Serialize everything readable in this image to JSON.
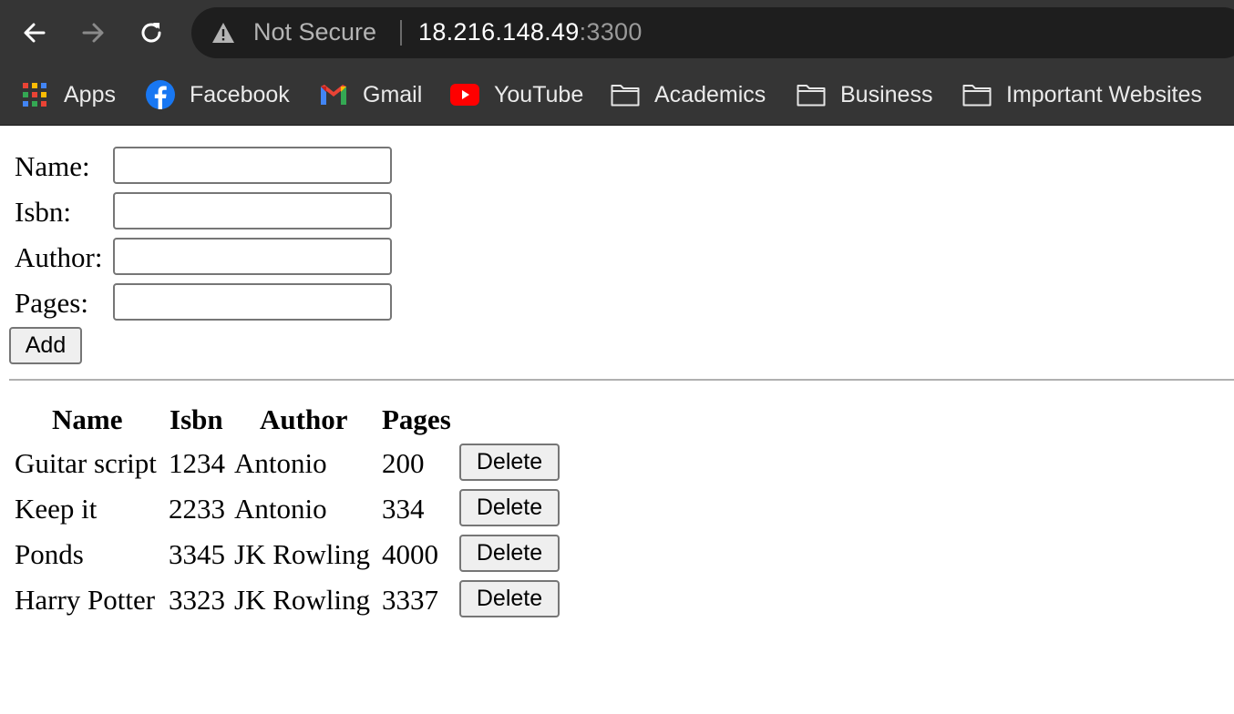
{
  "browser": {
    "security_label": "Not Secure",
    "url_host": "18.216.148.49",
    "url_port": ":3300",
    "icons": {
      "back": "arrow-left-icon",
      "forward": "arrow-right-icon",
      "reload": "reload-icon",
      "security": "warning-triangle-icon"
    },
    "bookmarks": [
      {
        "label": "Apps",
        "icon": "apps-grid-icon"
      },
      {
        "label": "Facebook",
        "icon": "facebook-icon",
        "color": "#1877f2"
      },
      {
        "label": "Gmail",
        "icon": "gmail-icon"
      },
      {
        "label": "YouTube",
        "icon": "youtube-icon",
        "color": "#ff0000"
      },
      {
        "label": "Academics",
        "icon": "folder-icon"
      },
      {
        "label": "Business",
        "icon": "folder-icon"
      },
      {
        "label": "Important Websites",
        "icon": "folder-icon"
      }
    ]
  },
  "form": {
    "fields": [
      {
        "label": "Name:",
        "value": ""
      },
      {
        "label": "Isbn:",
        "value": ""
      },
      {
        "label": "Author:",
        "value": ""
      },
      {
        "label": "Pages:",
        "value": ""
      }
    ],
    "add_label": "Add"
  },
  "table": {
    "headers": [
      "Name",
      "Isbn",
      "Author",
      "Pages"
    ],
    "rows": [
      {
        "name": "Guitar script",
        "isbn": "1234",
        "author": "Antonio",
        "pages": "200",
        "action": "Delete"
      },
      {
        "name": "Keep it",
        "isbn": "2233",
        "author": "Antonio",
        "pages": "334",
        "action": "Delete"
      },
      {
        "name": "Ponds",
        "isbn": "3345",
        "author": "JK Rowling",
        "pages": "4000",
        "action": "Delete"
      },
      {
        "name": "Harry Potter",
        "isbn": "3323",
        "author": "JK Rowling",
        "pages": "3337",
        "action": "Delete"
      }
    ]
  }
}
